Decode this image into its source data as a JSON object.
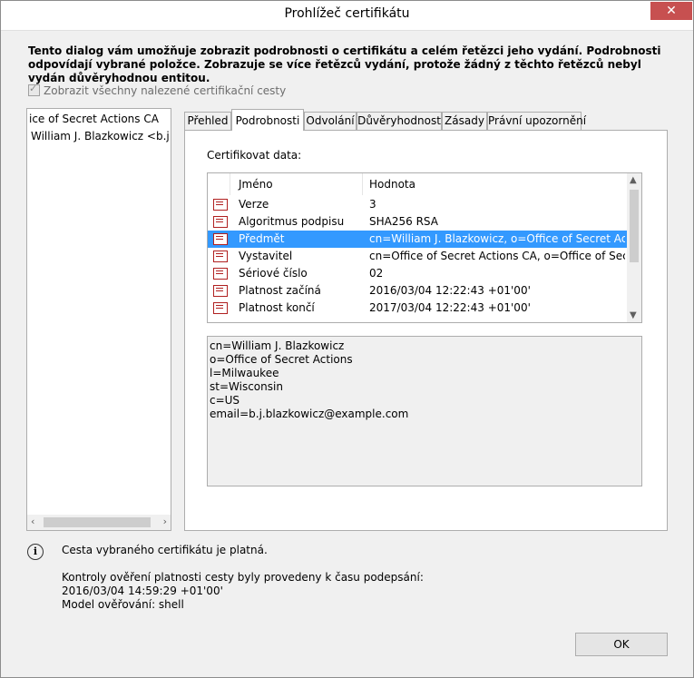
{
  "window": {
    "title": "Prohlížeč certifikátu",
    "close_icon": "close-icon"
  },
  "intro_text": "Tento dialog vám umožňuje zobrazit podrobnosti o certifikátu a celém řetězci jeho vydání. Podrobnosti odpovídají vybrané položce. Zobrazuje se více řetězců vydání, protože žádný z těchto řetězců nebyl vydán důvěryhodnou entitou.",
  "show_all_paths": {
    "label": "Zobrazit všechny nalezené certifikační cesty",
    "checked": true
  },
  "tree": [
    "ice of Secret Actions CA",
    "William J. Blazkowicz <b.j.bla"
  ],
  "tabs": [
    "Přehled",
    "Podrobnosti",
    "Odvolání",
    "Důvěryhodnost",
    "Zásady",
    "Právní upozornění"
  ],
  "active_tab": 1,
  "details": {
    "label": "Certifikovat data:",
    "columns": [
      "Jméno",
      "Hodnota"
    ],
    "rows": [
      {
        "name": "Verze",
        "value": "3"
      },
      {
        "name": "Algoritmus podpisu",
        "value": "SHA256 RSA"
      },
      {
        "name": "Předmět",
        "value": "cn=William J. Blazkowicz, o=Office of Secret Actio..."
      },
      {
        "name": "Vystavitel",
        "value": "cn=Office of Secret Actions CA, o=Office of Secre..."
      },
      {
        "name": "Sériové číslo",
        "value": "02"
      },
      {
        "name": "Platnost začíná",
        "value": "2016/03/04 12:22:43 +01'00'"
      },
      {
        "name": "Platnost končí",
        "value": "2017/03/04 12:22:43 +01'00'"
      }
    ],
    "selected_row": 2,
    "detail_lines": [
      "cn=William J. Blazkowicz",
      "o=Office of Secret Actions",
      "l=Milwaukee",
      "st=Wisconsin",
      "c=US",
      "email=b.j.blazkowicz@example.com"
    ]
  },
  "status": {
    "icon": "info-icon",
    "text": "Cesta vybraného certifikátu je platná.",
    "validation_line1": "Kontroly ověření platnosti cesty byly provedeny k času podepsání:",
    "validation_line2": "2016/03/04 14:59:29 +01'00'",
    "validation_line3": "Model ověřování: shell"
  },
  "ok_label": "OK"
}
